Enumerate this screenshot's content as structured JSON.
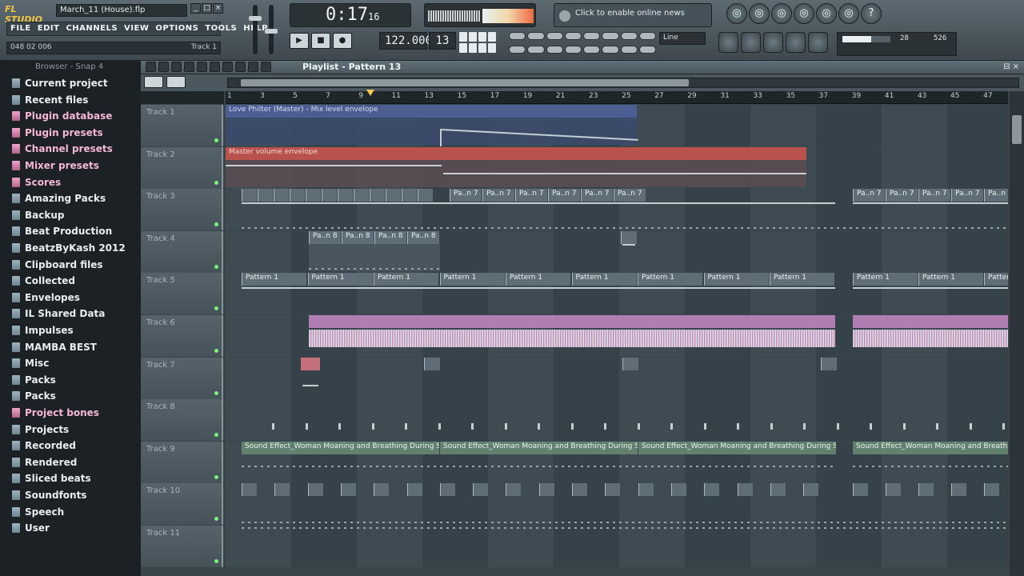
{
  "app": {
    "logo_text": "FL STUDIO",
    "filename": "March_11 (House).flp",
    "menus": [
      "FILE",
      "EDIT",
      "CHANNELS",
      "VIEW",
      "OPTIONS",
      "TOOLS",
      "HELP"
    ],
    "hint_left": "048 02 006",
    "hint_right": "Track 1",
    "time_main": "0:17",
    "time_small": "16",
    "news_text": "Click to enable online news",
    "tempo": "122.000",
    "pattern_number": "13",
    "snap_label": "Line",
    "monitor_values": [
      "28",
      "526"
    ]
  },
  "browser": {
    "header": "Browser - Snap 4",
    "items": [
      {
        "label": "Current project",
        "color": "blue"
      },
      {
        "label": "Recent files",
        "color": "blue"
      },
      {
        "label": "Plugin database",
        "color": "pink"
      },
      {
        "label": "Plugin presets",
        "color": "pink"
      },
      {
        "label": "Channel presets",
        "color": "pink"
      },
      {
        "label": "Mixer presets",
        "color": "pink"
      },
      {
        "label": "Scores",
        "color": "pink"
      },
      {
        "label": "Amazing Packs",
        "color": "blue"
      },
      {
        "label": "Backup",
        "color": "blue"
      },
      {
        "label": "Beat Production",
        "color": "blue"
      },
      {
        "label": "BeatzByKash 2012",
        "color": "blue"
      },
      {
        "label": "Clipboard files",
        "color": "blue"
      },
      {
        "label": "Collected",
        "color": "blue"
      },
      {
        "label": "Envelopes",
        "color": "blue"
      },
      {
        "label": "IL Shared Data",
        "color": "blue"
      },
      {
        "label": "Impulses",
        "color": "blue"
      },
      {
        "label": "MAMBA BEST",
        "color": "blue"
      },
      {
        "label": "Misc",
        "color": "blue"
      },
      {
        "label": "Packs",
        "color": "blue"
      },
      {
        "label": "Packs",
        "color": "blue"
      },
      {
        "label": "Project bones",
        "color": "pink"
      },
      {
        "label": "Projects",
        "color": "blue"
      },
      {
        "label": "Recorded",
        "color": "blue"
      },
      {
        "label": "Rendered",
        "color": "blue"
      },
      {
        "label": "Sliced beats",
        "color": "blue"
      },
      {
        "label": "Soundfonts",
        "color": "blue"
      },
      {
        "label": "Speech",
        "color": "blue"
      },
      {
        "label": "User",
        "color": "blue"
      }
    ]
  },
  "playlist": {
    "title": "Playlist - Pattern 13",
    "ruler": [
      "1",
      "3",
      "5",
      "7",
      "9",
      "11",
      "13",
      "15",
      "17",
      "19",
      "21",
      "23",
      "25",
      "27",
      "29",
      "31",
      "33",
      "35",
      "37",
      "39",
      "41",
      "43",
      "45",
      "47"
    ],
    "tracks": [
      {
        "name": "Track 1",
        "clips": [
          {
            "label": "Love Philter (Master) - Mix level envelope",
            "style": "blue"
          }
        ]
      },
      {
        "name": "Track 2",
        "clips": [
          {
            "label": "Master volume envelope",
            "style": "red"
          }
        ]
      },
      {
        "name": "Track 3",
        "clips": [
          {
            "label": "Pa..n 7",
            "style": "gray"
          }
        ]
      },
      {
        "name": "Track 4",
        "clips": [
          {
            "label": "Pa..n 8",
            "style": "gray"
          }
        ]
      },
      {
        "name": "Track 5",
        "clips": [
          {
            "label": "Pattern 1",
            "style": "gray"
          }
        ]
      },
      {
        "name": "Track 6",
        "clips": []
      },
      {
        "name": "Track 7",
        "clips": []
      },
      {
        "name": "Track 8",
        "clips": []
      },
      {
        "name": "Track 9",
        "clips": [
          {
            "label": "Sound Effect_Woman Moaning and Breathing During Sex",
            "style": "green"
          }
        ]
      },
      {
        "name": "Track 10",
        "clips": []
      },
      {
        "name": "Track 11",
        "clips": []
      }
    ]
  },
  "colors": {
    "accent": "#f2c94c",
    "envelope_blue": "#4b5d91",
    "envelope_red": "#b9524d",
    "audio_pink": "#b07eb3",
    "audio_green": "#63806f"
  }
}
